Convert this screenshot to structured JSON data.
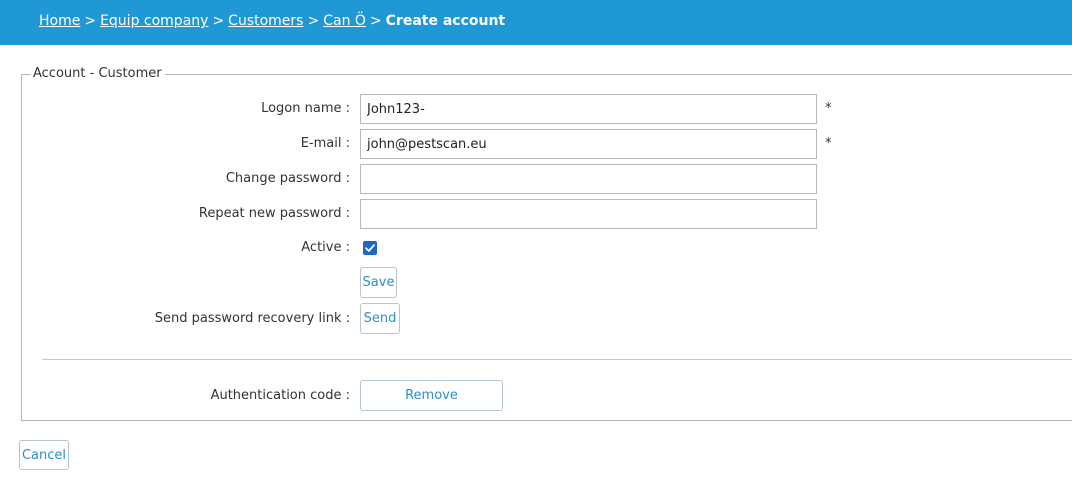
{
  "breadcrumb": {
    "home": "Home",
    "company": "Equip company",
    "customers": "Customers",
    "customer": "Can Ö",
    "current": "Create account",
    "separator": ">"
  },
  "section": {
    "legend": "Account - Customer"
  },
  "form": {
    "logon_label": "Logon name :",
    "logon_value": "John123-",
    "email_label": "E-mail :",
    "email_value": "john@pestscan.eu",
    "change_password_label": "Change password :",
    "change_password_value": "",
    "repeat_password_label": "Repeat new password :",
    "repeat_password_value": "",
    "active_label": "Active :",
    "active_checked": true,
    "required_marker": "*",
    "save_label": "Save",
    "recovery_label": "Send password recovery link :",
    "send_label": "Send",
    "auth_label": "Authentication code :",
    "remove_label": "Remove"
  },
  "footer": {
    "cancel_label": "Cancel"
  },
  "colors": {
    "topbar": "#2198d6",
    "button_text": "#2b8fc8",
    "checkbox": "#1a66c9"
  }
}
